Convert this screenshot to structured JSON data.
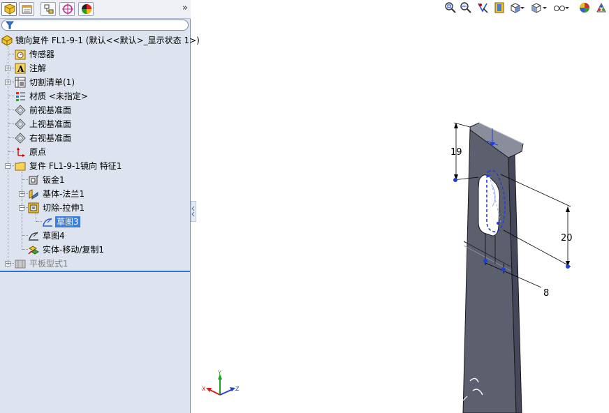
{
  "feature_manager": {
    "tabs": [
      "feature-manager-tab",
      "property-manager-tab",
      "configuration-manager-tab",
      "dimxpert-tab",
      "display-manager-tab"
    ],
    "more_label": "»",
    "root": "镜向复件 FL1-9-1  (默认<<默认>_显示状态 1>)",
    "items": [
      {
        "label": "传感器",
        "icon": "sensor-icon"
      },
      {
        "label": "注解",
        "icon": "annotation-icon"
      },
      {
        "label": "切割清单(1)",
        "icon": "cut-list-icon"
      },
      {
        "label": "材质 <未指定>",
        "icon": "material-icon"
      },
      {
        "label": "前视基准面",
        "icon": "plane-icon"
      },
      {
        "label": "上视基准面",
        "icon": "plane-icon"
      },
      {
        "label": "右视基准面",
        "icon": "plane-icon"
      },
      {
        "label": "原点",
        "icon": "origin-icon"
      },
      {
        "label": "复件 FL1-9-1镜向 特征1",
        "icon": "folder-icon"
      },
      {
        "label": "钣金1",
        "icon": "sheet-metal-icon"
      },
      {
        "label": "基体-法兰1",
        "icon": "base-flange-icon"
      },
      {
        "label": "切除-拉伸1",
        "icon": "cut-extrude-icon"
      },
      {
        "label": "草图3",
        "icon": "sketch-icon"
      },
      {
        "label": "草图4",
        "icon": "sketch-icon"
      },
      {
        "label": "实体-移动/复制1",
        "icon": "move-copy-body-icon"
      },
      {
        "label": "平板型式1",
        "icon": "flat-pattern-icon"
      }
    ]
  },
  "heads_up_toolbar": [
    "zoom-to-fit-icon",
    "zoom-to-area-icon",
    "previous-view-icon",
    "section-view-icon",
    "view-orientation-icon",
    "display-style-icon",
    "hide-show-items-icon",
    "edit-appearance-icon",
    "apply-scene-icon"
  ],
  "dimensions": {
    "d1": "19",
    "d2": "20",
    "d3": "8"
  },
  "triad": {
    "x": "X",
    "y": "Y",
    "z": "Z"
  },
  "colors": {
    "selection": "#3d7fd6",
    "sketch": "#1f3fd8",
    "part_face": "#5b5f6e",
    "panel_bg": "#dde4ef"
  }
}
